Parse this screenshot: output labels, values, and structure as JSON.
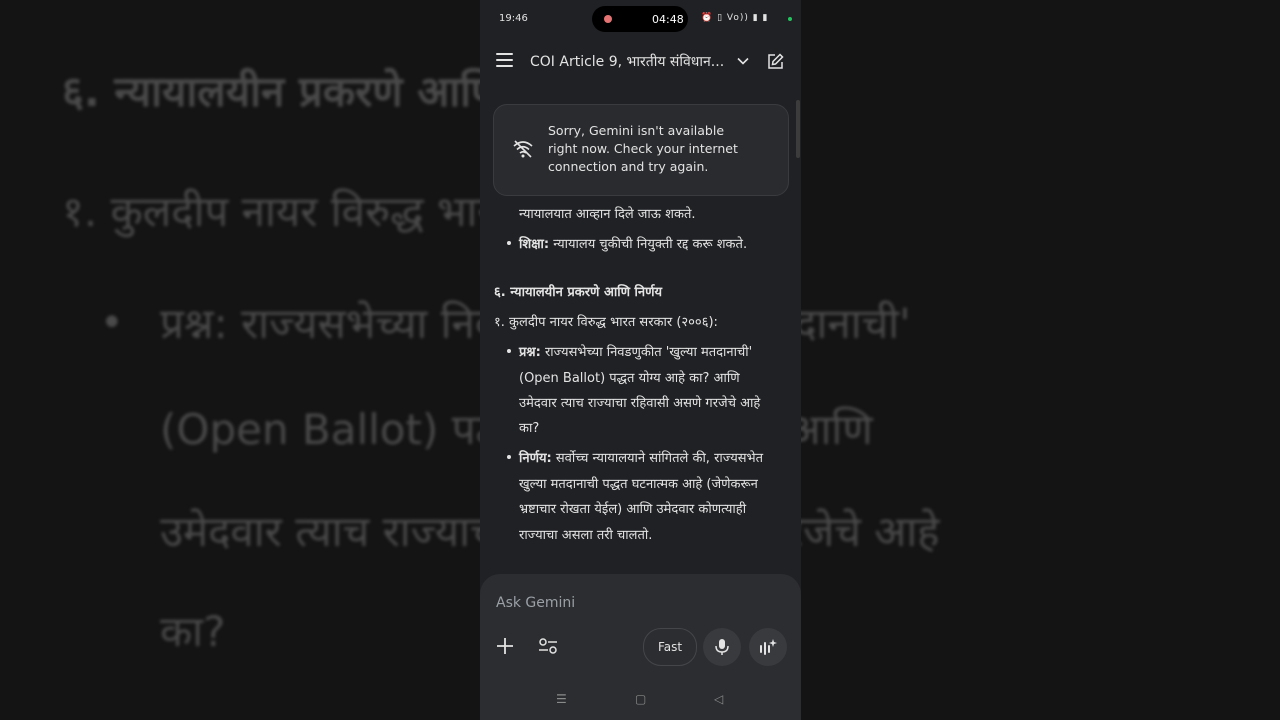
{
  "background": {
    "lines": [
      "६. न्यायालयीन प्रकरणे आणि निर्णय",
      "१. कुलदीप नायर विरुद्ध भारत सरकार (२००६):",
      "प्रश्न: राज्यसभेच्या निवडणुकीत 'खुल्या मतदानाची'",
      "(Open Ballot) पद्धत योग्य आहे का? आणि",
      "उमेदवार त्याच राज्याचा रहिवासी असणे गरजेचे आहे",
      "का?"
    ]
  },
  "status_bar": {
    "time": "19:46",
    "recording_time": "04:48",
    "icons": "⏰ ▯ Vo)) ▮ ▮"
  },
  "header": {
    "title": "COI Article 9, भारतीय संविधान...",
    "menu_icon": "hamburger-icon",
    "dropdown_icon": "chevron-down-icon",
    "new_chat_icon": "edit-icon"
  },
  "toast": {
    "icon": "wifi-off-icon",
    "message": "Sorry, Gemini isn't available right now. Check your internet connection and try again."
  },
  "content": {
    "partial_line": "न्यायालयात आव्हान दिले जाऊ शकते.",
    "shiksha_label": "शिक्षा:",
    "shiksha_text": "न्यायालय चुकीची नियुक्ती रद्द करू शकते.",
    "section_heading": "६. न्यायालयीन प्रकरणे आणि निर्णय",
    "case_title": "१. कुलदीप नायर विरुद्ध भारत सरकार (२००६):",
    "question_label": "प्रश्न:",
    "question_lines": [
      "राज्यसभेच्या निवडणुकीत 'खुल्या मतदानाची'",
      "(Open Ballot) पद्धत योग्य आहे का? आणि",
      "उमेदवार त्याच राज्याचा रहिवासी असणे गरजेचे आहे",
      "का?"
    ],
    "verdict_label": "निर्णय:",
    "verdict_lines": [
      "सर्वोच्च न्यायालयाने सांगितले की, राज्यसभेत",
      "खुल्या मतदानाची पद्धत घटनात्मक आहे (जेणेकरून",
      "भ्रष्टाचार रोखता येईल) आणि उमेदवार कोणत्याही",
      "राज्याचा असला तरी चालतो."
    ]
  },
  "composer": {
    "placeholder": "Ask Gemini",
    "mode_label": "Fast",
    "add_icon": "plus-icon",
    "tools_icon": "tune-icon",
    "mic_icon": "mic-icon",
    "live_icon": "live-icon"
  },
  "nav_bar": {
    "recents": "☰",
    "home": "▢",
    "back": "◁"
  }
}
